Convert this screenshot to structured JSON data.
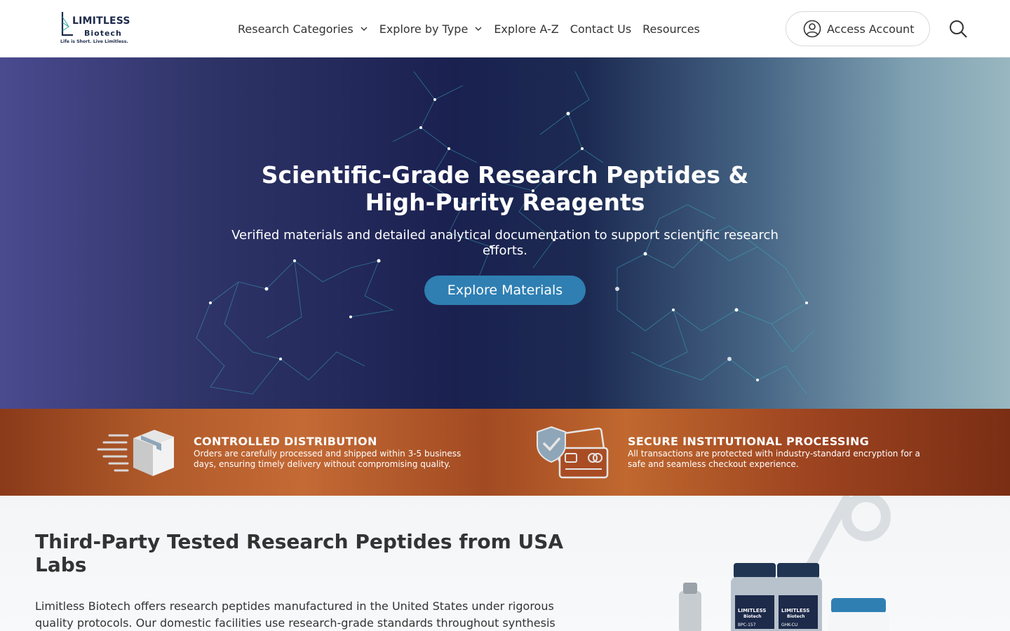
{
  "header": {
    "logo": {
      "name": "LIMITLESS",
      "sub": "Biotech",
      "tagline": "Life is Short. Live Limitless."
    },
    "nav": [
      {
        "label": "Research Categories",
        "has_dropdown": true
      },
      {
        "label": "Explore by Type",
        "has_dropdown": true
      },
      {
        "label": "Explore A-Z",
        "has_dropdown": false
      },
      {
        "label": "Contact Us",
        "has_dropdown": false
      },
      {
        "label": "Resources",
        "has_dropdown": false
      }
    ],
    "account_label": "Access Account",
    "account_icon": "user-circle-icon",
    "search_icon": "search-icon"
  },
  "hero": {
    "title_bold": "Scientific-Grade Research Peptides",
    "title_rest": " &  High-Purity Reagents",
    "subtitle": "Verified materials and detailed analytical documentation to support scientific research efforts.",
    "cta_label": "Explore Materials"
  },
  "features": [
    {
      "icon": "shipping-box-icon",
      "title": "CONTROLLED DISTRIBUTION",
      "desc": "Orders are carefully processed and shipped within 3-5 business days, ensuring timely delivery without compromising quality."
    },
    {
      "icon": "secure-card-shield-icon",
      "title": "SECURE INSTITUTIONAL PROCESSING",
      "desc": "All transactions are protected with industry-standard encryption for a safe and seamless checkout experience."
    }
  ],
  "intro": {
    "title": "Third-Party Tested Research Peptides from USA Labs",
    "text": "Limitless Biotech offers research peptides manufactured in the United States under rigorous quality protocols. Our domestic facilities use research-grade standards throughout synthesis",
    "vial_labels": [
      "LIMITLESS",
      "Biotech",
      "BPC-157",
      "GHK-CU"
    ]
  },
  "colors": {
    "brand_navy": "#1d2a4a",
    "cta_blue": "#2f7fb3",
    "feature_bar": "#b05a2a"
  }
}
